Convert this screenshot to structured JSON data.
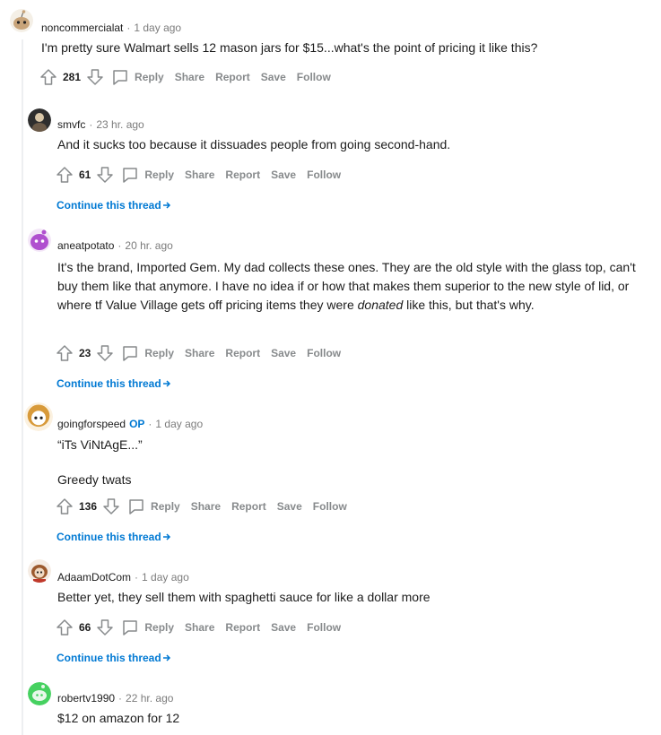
{
  "actions": {
    "reply": "Reply",
    "share": "Share",
    "report": "Report",
    "save": "Save",
    "follow": "Follow"
  },
  "continue_label": "Continue this thread",
  "comments": [
    {
      "username": "noncommercialat",
      "timestamp": "1 day ago",
      "paragraphs": [
        "I'm pretty sure Walmart sells 12 mason jars for $15...what's the point of pricing it like this?"
      ],
      "score": "281",
      "avatar_color": "#c8a47a"
    },
    {
      "username": "smvfc",
      "timestamp": "23 hr. ago",
      "paragraphs": [
        "And it sucks too because it dissuades people from going second-hand."
      ],
      "score": "61",
      "avatar_color": "#2e2e2e"
    },
    {
      "username": "aneatpotato",
      "timestamp": "20 hr. ago",
      "paragraph_parts": [
        "It's the brand, Imported Gem. My dad collects these ones. They are the old style with the glass top, can't buy them like that anymore. I have no idea if or how that makes them superior to the new style of lid, or where tf Value Village gets off pricing items they were ",
        "donated",
        " like this, but that's why."
      ],
      "score": "23",
      "avatar_color": "#b04fcf"
    },
    {
      "username": "goingforspeed",
      "op_badge": "OP",
      "timestamp": "1 day ago",
      "paragraphs": [
        "“iTs ViNtAgE...”",
        "Greedy twats"
      ],
      "score": "136",
      "avatar_color": "#d89a3a"
    },
    {
      "username": "AdaamDotCom",
      "timestamp": "1 day ago",
      "paragraphs": [
        "Better yet, they sell them with spaghetti sauce for like a dollar more"
      ],
      "score": "66",
      "avatar_color": "#9c5a2e"
    },
    {
      "username": "robertv1990",
      "timestamp": "22 hr. ago",
      "paragraphs": [
        "$12 on amazon for 12"
      ],
      "avatar_color": "#46d160"
    }
  ]
}
